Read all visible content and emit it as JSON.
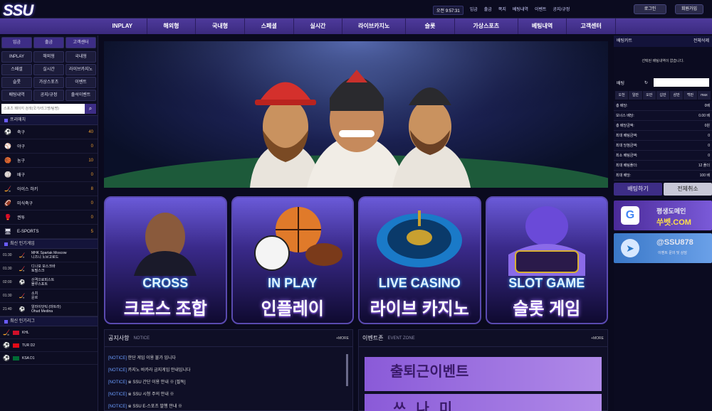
{
  "header": {
    "logo": "SSU",
    "clock": "오전 9:57:31",
    "links": [
      "입금",
      "출금",
      "쪽지",
      "베팅내역",
      "이벤트",
      "공지/규정"
    ],
    "login": "로그인",
    "signup": "회원가입"
  },
  "nav": [
    "INPLAY",
    "해외형",
    "국내형",
    "스페셜",
    "실시간",
    "라이브카지노",
    "슬롯",
    "가상스포츠",
    "베팅내역",
    "고객센터"
  ],
  "sidebar": {
    "top_buttons": [
      "입금",
      "출금",
      "고객센터"
    ],
    "menu": [
      "INPLAY",
      "해외형",
      "국내형",
      "스페셜",
      "실시간",
      "라이브카지노",
      "슬롯",
      "가상스포츠",
      "이벤트",
      "배팅내역",
      "공지/규정",
      "출석이벤트"
    ],
    "search_placeholder": "스포츠 페이지 검색(국가/리그명/팀명)",
    "sports_title": "프리매치",
    "sports": [
      {
        "icon": "soccer-ball-icon",
        "glyph": "⚽",
        "name": "축구",
        "count": "40"
      },
      {
        "icon": "baseball-icon",
        "glyph": "⚾",
        "name": "야구",
        "count": "0"
      },
      {
        "icon": "basketball-icon",
        "glyph": "🏀",
        "name": "농구",
        "count": "10"
      },
      {
        "icon": "volleyball-icon",
        "glyph": "🏐",
        "name": "배구",
        "count": "0"
      },
      {
        "icon": "hockey-icon",
        "glyph": "🏒",
        "name": "아이스 하키",
        "count": "8"
      },
      {
        "icon": "football-icon",
        "glyph": "🏈",
        "name": "미식축구",
        "count": "0"
      },
      {
        "icon": "boxing-icon",
        "glyph": "🥊",
        "name": "권투",
        "count": "0"
      },
      {
        "icon": "esports-icon",
        "glyph": "🖥",
        "name": "E-SPORTS",
        "count": "5"
      }
    ],
    "games_title": "최신 인기게임",
    "games": [
      {
        "time": "01:30",
        "icon": "hockey-icon",
        "glyph": "🏒",
        "home": "MHK Spartak Moscow",
        "away": "니즈니 노브고로드"
      },
      {
        "time": "01:30",
        "icon": "hockey-icon",
        "glyph": "🏒",
        "home": "디나모 모스크바",
        "away": "토필스크"
      },
      {
        "time": "02:00",
        "icon": "soccer-ball-icon",
        "glyph": "⚽",
        "home": "산격으로피스트",
        "away": "블루스포트"
      },
      {
        "time": "01:30",
        "icon": "hockey-icon",
        "glyph": "🏒",
        "home": "소치",
        "away": "운르"
      },
      {
        "time": "21:40",
        "icon": "soccer-ball-icon",
        "glyph": "⚽",
        "home": "알라이앗틱 (마트라)",
        "away": "Ohud Medina"
      }
    ],
    "leagues_title": "최신 인기리그",
    "leagues": [
      {
        "icon": "hockey-icon",
        "glyph": "🏒",
        "name": "KHL"
      },
      {
        "icon": "soccer-ball-icon",
        "glyph": "⚽",
        "name": "TUR D2"
      },
      {
        "icon": "soccer-ball-icon",
        "glyph": "⚽",
        "name": "KSA D1"
      }
    ]
  },
  "cards": [
    {
      "en": "CROSS",
      "ko": "크로스 조합"
    },
    {
      "en": "IN PLAY",
      "ko": "인플레이"
    },
    {
      "en": "LIVE CASINO",
      "ko": "라이브 카지노"
    },
    {
      "en": "SLOT GAME",
      "ko": "슬롯 게임"
    }
  ],
  "notice": {
    "title": "공지사항",
    "sub": "NOTICE",
    "more": "+MORE",
    "items": [
      "[NOTICE] 한단 게임 이용 불가 입니다",
      "[NOTICE] 카지노 바카라 금지게임 안내입니다",
      "[NOTICE] ※ SSU 간단 이용 안내 ※ [필독]",
      "[NOTICE] ※ SSU 시청 주의 안내 ※",
      "[NOTICE] ※ SSU E-스포츠 발행 안내 ※"
    ]
  },
  "event": {
    "title": "이벤트존",
    "sub": "EVENT ZONE",
    "more": "+MORE",
    "items": [
      "출퇴근이벤트",
      "쓰나미"
    ]
  },
  "betslip": {
    "title": "배팅카트",
    "clear": "전체삭제",
    "empty": "선택된 배팅내역이 없습니다.",
    "bet_label": "배팅",
    "quick": [
      "오천",
      "일만",
      "오만",
      "십만",
      "삼만",
      "백만",
      "max"
    ],
    "rows": [
      {
        "k": "총 배당:",
        "v": "0배"
      },
      {
        "k": "보너스 배당:",
        "v": "0.00 배"
      },
      {
        "k": "총 배당금액:",
        "v": "0원"
      },
      {
        "k": "최대 배팅금액:",
        "v": "0"
      },
      {
        "k": "최대 당첨금액:",
        "v": "0"
      },
      {
        "k": "최소 배팅금액:",
        "v": "0"
      },
      {
        "k": "최대 배팅폴더:",
        "v": "12 폴더"
      },
      {
        "k": "최대 배당:",
        "v": "100 배"
      }
    ],
    "bet_btn": "배팅하기",
    "cancel_btn": "전체취소"
  },
  "promo": {
    "google_line1": "평생도메인",
    "google_line2": "쑤벳.COM",
    "tg_title": "@SSU878",
    "tg_sub": "이벤트 문의 및 상담"
  }
}
